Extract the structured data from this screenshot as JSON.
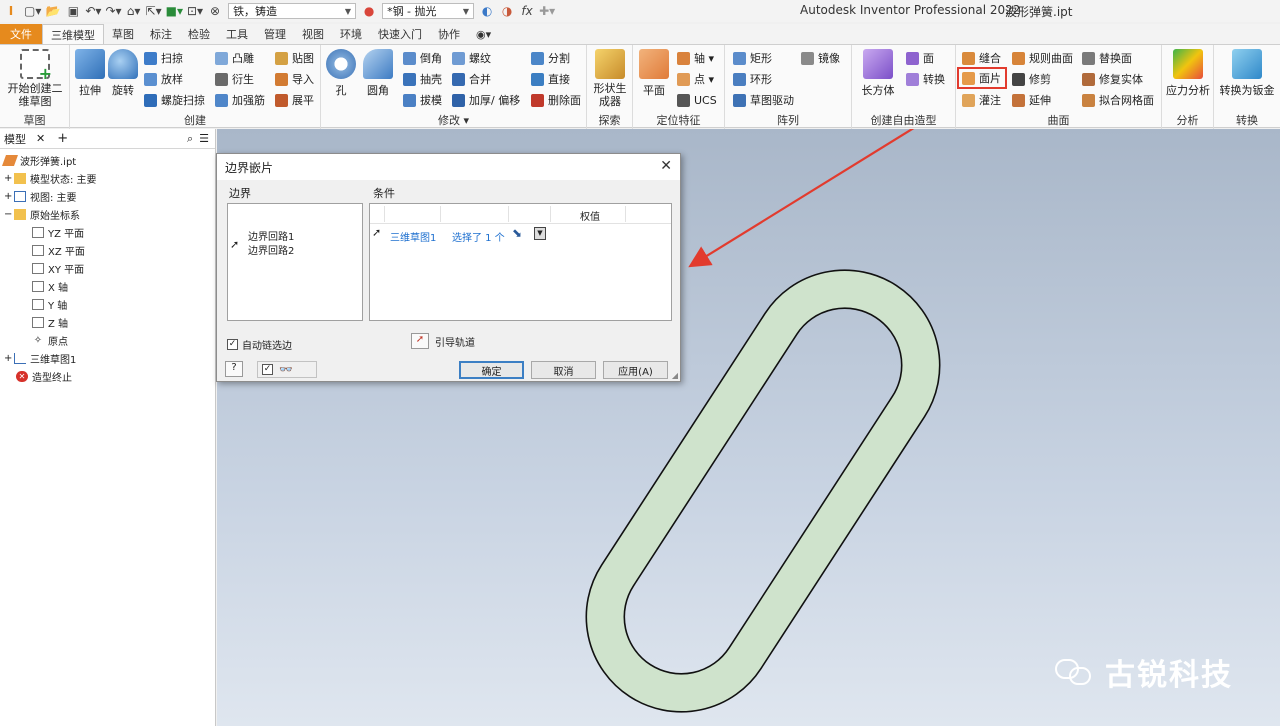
{
  "quick_access": {
    "material_combo": "铁，铸造",
    "appearance_combo": "*钢 - 抛光",
    "fx_label": "fx"
  },
  "app_title": "Autodesk Inventor Professional 2022",
  "doc_title": "波形弹簧.ipt",
  "tabs": [
    "文件",
    "三维模型",
    "草图",
    "标注",
    "检验",
    "工具",
    "管理",
    "视图",
    "环境",
    "快速入门",
    "协作"
  ],
  "ribbon": {
    "sketch_panel": {
      "title": "草图",
      "start_sketch": "开始创建二维草图"
    },
    "create_panel": {
      "title": "创建",
      "extrude": "拉伸",
      "revolve": "旋转",
      "sweep": "扫掠",
      "loft": "放样",
      "coil": "螺旋扫掠",
      "emboss": "凸雕",
      "derive": "衍生",
      "rib": "加强筋",
      "decal": "贴图",
      "import": "导入",
      "unwrap": "展平"
    },
    "modify_panel": {
      "title": "修改",
      "hole": "孔",
      "fillet": "圆角",
      "chamfer": "倒角",
      "shell": "抽壳",
      "draft": "拔模",
      "thread": "螺纹",
      "combine": "合并",
      "thicken": "加厚/ 偏移",
      "split": "分割",
      "direct": "直接",
      "delete_face": "删除面"
    },
    "explore_panel": {
      "title": "探索",
      "shape_generator": "形状生成器"
    },
    "work_panel": {
      "title": "定位特征",
      "plane": "平面",
      "axis": "轴",
      "point": "点",
      "ucs": "UCS"
    },
    "pattern_panel": {
      "title": "阵列",
      "rectangular": "矩形",
      "circular": "环形",
      "sketch_driven": "草图驱动",
      "mirror": "镜像"
    },
    "freeform_panel": {
      "title": "创建自由造型",
      "box": "长方体",
      "face": "面",
      "convert": "转换"
    },
    "surface_panel": {
      "title": "曲面",
      "stitch": "缝合",
      "patch": "面片",
      "sculpt": "灌注",
      "ruled": "规则曲面",
      "trim": "修剪",
      "extend": "延伸",
      "replace": "替换面",
      "repair": "修复实体",
      "fit_mesh": "拟合网格面"
    },
    "analysis_panel": {
      "title": "分析",
      "stress": "应力分析"
    },
    "convert_panel": {
      "title": "转换",
      "sheetmetal": "转换为钣金"
    }
  },
  "browser": {
    "tab": "模型",
    "items": [
      {
        "label": "波形弹簧.ipt",
        "icon": "part-icon"
      },
      {
        "label": "模型状态: 主要",
        "icon": "folder-icon"
      },
      {
        "label": "视图: 主要",
        "icon": "view-icon"
      },
      {
        "label": "原始坐标系",
        "icon": "folder-icon"
      },
      {
        "label": "YZ 平面",
        "icon": "plane-icon"
      },
      {
        "label": "XZ 平面",
        "icon": "plane-icon"
      },
      {
        "label": "XY 平面",
        "icon": "plane-icon"
      },
      {
        "label": "X 轴",
        "icon": "axis-icon"
      },
      {
        "label": "Y 轴",
        "icon": "axis-icon"
      },
      {
        "label": "Z 轴",
        "icon": "axis-icon"
      },
      {
        "label": "原点",
        "icon": "origin-icon"
      },
      {
        "label": "三维草图1",
        "icon": "sketch-icon"
      },
      {
        "label": "造型终止",
        "icon": "end-of-part-icon"
      }
    ]
  },
  "dialog": {
    "title": "边界嵌片",
    "boundary_header": "边界",
    "condition_header": "条件",
    "weight_header": "权值",
    "loops": [
      "边界回路1",
      "边界回路2"
    ],
    "condition_row": {
      "sketch": "三维草图1",
      "selected": "选择了 1 个"
    },
    "auto_chain": "自动链选边",
    "guide_rails": "引导轨道",
    "ok": "确定",
    "cancel": "取消",
    "apply": "应用(A)"
  },
  "watermark": "古锐科技",
  "colors": {
    "file_tab": "#e68a1d",
    "highlight": "#e23b2e",
    "patch_fill": "#cfe3cc",
    "link_blue": "#1d6fcf"
  }
}
